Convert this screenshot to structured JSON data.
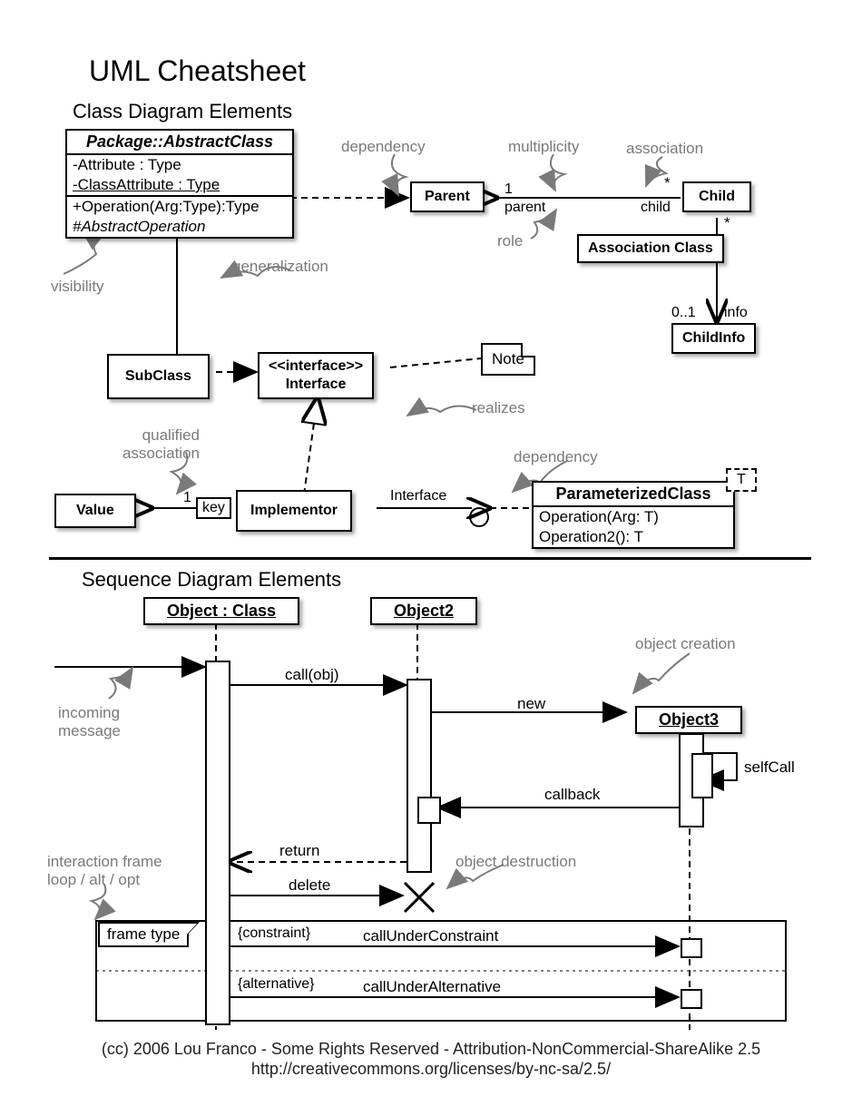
{
  "title": "UML Cheatsheet",
  "section1": "Class Diagram Elements",
  "section2": "Sequence Diagram Elements",
  "abstract": {
    "name": "Package::AbstractClass",
    "attr1": "-Attribute : Type",
    "attr2": "-ClassAttribute : Type",
    "op1": "+Operation(Arg:Type):Type",
    "op2": "#AbstractOperation"
  },
  "parent": "Parent",
  "child": "Child",
  "assocClass": "Association Class",
  "childInfo": "ChildInfo",
  "subClass": "SubClass",
  "interface": {
    "stereo": "<<interface>>",
    "name": "Interface"
  },
  "noteText": "Note",
  "value": "Value",
  "keyLabel": "key",
  "implementor": "Implementor",
  "paramClass": {
    "name": "ParameterizedClass",
    "op1": "Operation(Arg: T)",
    "op2": "Operation2(): T",
    "T": "T"
  },
  "labels": {
    "dependency": "dependency",
    "multiplicity": "multiplicity",
    "association": "association",
    "role": "role",
    "generalization": "generalization",
    "visibility": "visibility",
    "realizes": "realizes",
    "qualifiedAssoc": "qualified association",
    "dependency2": "dependency",
    "parentRole": "parent",
    "childRole": "child",
    "one": "1",
    "star": "*",
    "star2": "*",
    "zeroOne": "0..1",
    "info": "info",
    "interfaceLabel": "Interface",
    "oneQ": "1"
  },
  "seq": {
    "obj1": "Object : Class",
    "obj2": "Object2",
    "obj3": "Object3",
    "incoming": "incoming message",
    "objCreation": "object creation",
    "call": "call(obj)",
    "new": "new",
    "selfCall": "selfCall",
    "callback": "callback",
    "return": "return",
    "delete": "delete",
    "objDestruction": "object destruction",
    "frameLabel": "interaction frame loop / alt / opt",
    "frameType": "frame type",
    "constraint": "{constraint}",
    "callUC": "callUnderConstraint",
    "alternative": "{alternative}",
    "callUA": "callUnderAlternative"
  },
  "footer1": "(cc) 2006 Lou Franco - Some Rights Reserved - Attribution-NonCommercial-ShareAlike 2.5",
  "footer2": "http://creativecommons.org/licenses/by-nc-sa/2.5/"
}
